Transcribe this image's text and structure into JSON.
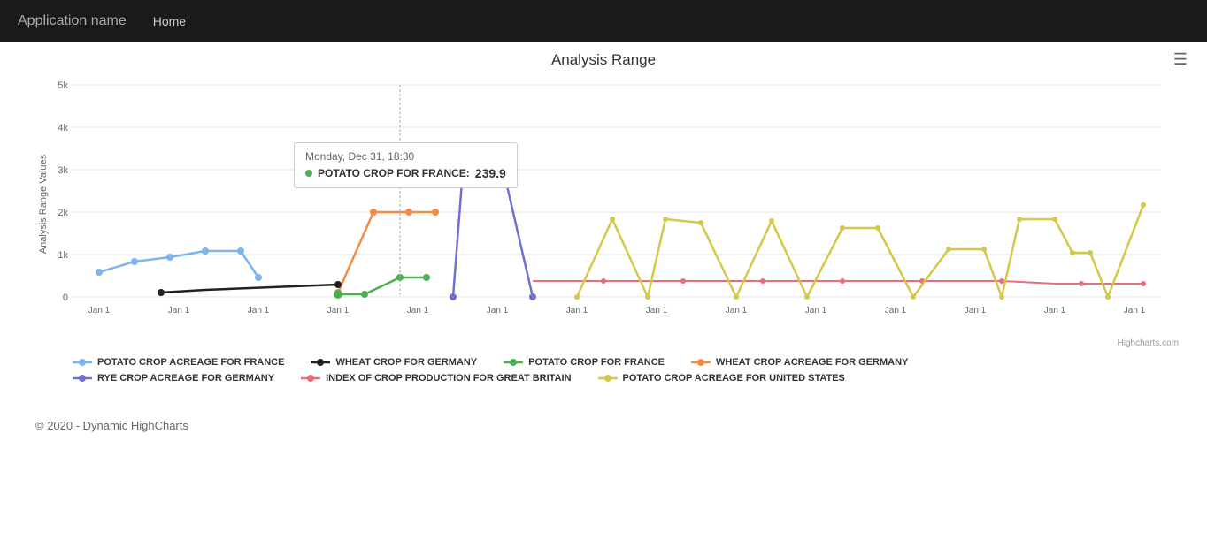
{
  "navbar": {
    "brand": "Application name",
    "links": [
      {
        "label": "Home",
        "href": "#"
      }
    ]
  },
  "chart": {
    "title": "Analysis Range",
    "hamburger_label": "☰",
    "y_axis_title": "Analysis Range Values",
    "y_axis_ticks": [
      "0",
      "1k",
      "2k",
      "3k",
      "4k",
      "5k"
    ],
    "x_axis_ticks": [
      "Jan 1",
      "Jan 1",
      "Jan 1",
      "Jan 1",
      "Jan 1",
      "Jan 1",
      "Jan 1",
      "Jan 1",
      "Jan 1",
      "Jan 1",
      "Jan 1",
      "Jan 1",
      "Jan 1",
      "Jan 1"
    ],
    "tooltip": {
      "date": "Monday, Dec 31, 18:30",
      "series_label": "POTATO CROP FOR FRANCE:",
      "value": "239.9",
      "dot_color": "#4CAF50"
    },
    "legend": [
      {
        "label": "POTATO CROP ACREAGE FOR FRANCE",
        "color": "#7cb5ec",
        "row": 0
      },
      {
        "label": "WHEAT CROP ACREAGE FOR GERMANY",
        "color": "#f28b45",
        "row": 1
      },
      {
        "label": "POTATO CROP ACREAGE FOR UNITED STATES",
        "color": "#d4c84a",
        "row": 2
      },
      {
        "label": "WHEAT CROP FOR GERMANY",
        "color": "#222",
        "row": 0
      },
      {
        "label": "RYE CROP ACREAGE FOR GERMANY",
        "color": "#7070d4",
        "row": 1
      },
      {
        "label": "POTATO CROP FOR FRANCE",
        "color": "#4CAF50",
        "row": 0
      },
      {
        "label": "INDEX OF CROP PRODUCTION FOR GREAT BRITAIN",
        "color": "#e86d7a",
        "row": 1
      }
    ],
    "credit": "Highcharts.com"
  },
  "footer": {
    "text": "© 2020 - Dynamic HighCharts"
  }
}
